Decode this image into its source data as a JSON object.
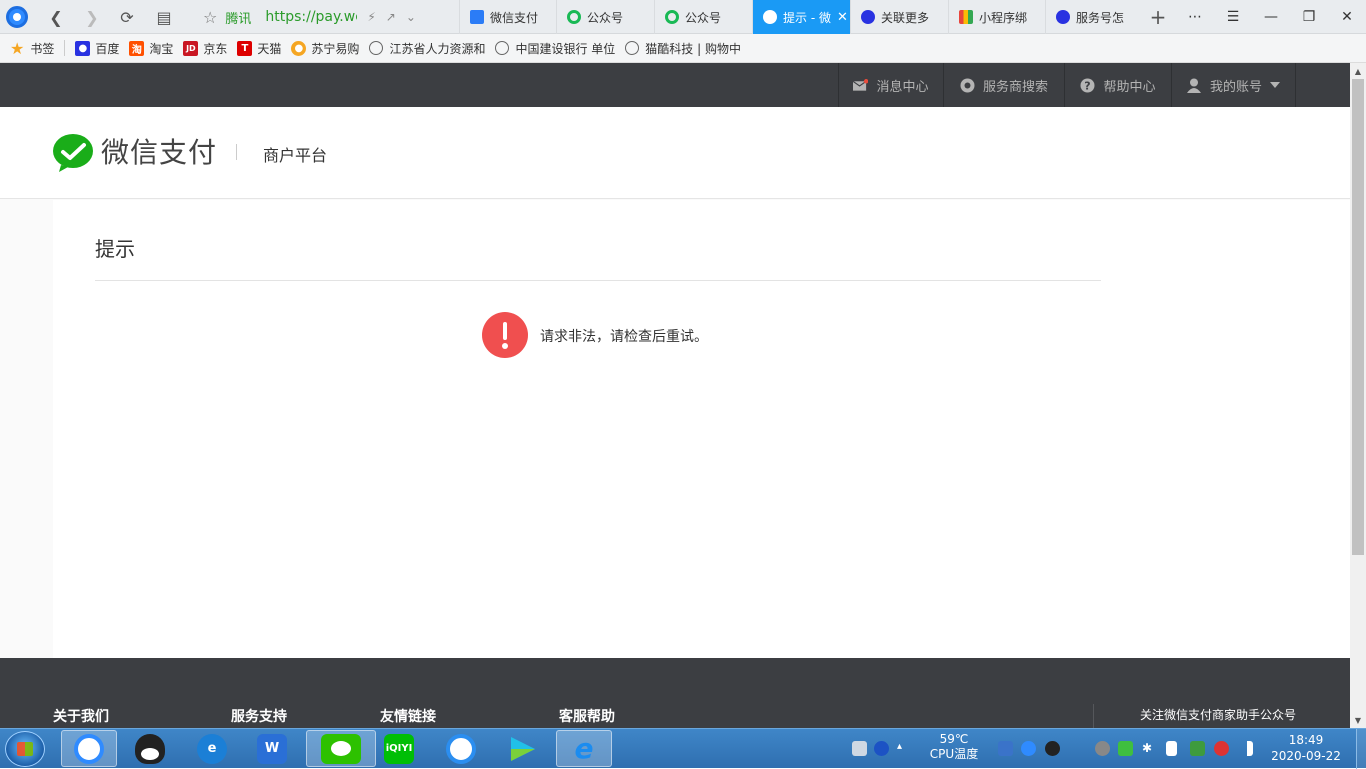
{
  "browser": {
    "address": {
      "site_label": "腾讯",
      "url": "https://pay.weixin.qq.com"
    },
    "tabs": [
      {
        "label": "微信支付",
        "icon": "doc-icon",
        "color": "#2b7cf6"
      },
      {
        "label": "公众号",
        "icon": "wechat-mp-icon",
        "color": "#19b955"
      },
      {
        "label": "公众号",
        "icon": "wechat-mp-icon",
        "color": "#19b955"
      },
      {
        "label": "提示 - 微",
        "icon": "wechat-pay-icon",
        "color": "#ffffff",
        "active": true
      },
      {
        "label": "关联更多",
        "icon": "baidu-paw-icon",
        "color": "#2932e1"
      },
      {
        "label": "小程序绑",
        "icon": "grid-apps-icon",
        "color": "#e8453c"
      },
      {
        "label": "服务号怎",
        "icon": "baidu-paw-icon",
        "color": "#2932e1"
      }
    ],
    "bookmarks": [
      {
        "label": "书签",
        "icon": "star-icon"
      },
      {
        "label": "百度",
        "icon": "baidu-paw-icon"
      },
      {
        "label": "淘宝",
        "icon": "taobao-icon"
      },
      {
        "label": "京东",
        "icon": "jd-icon"
      },
      {
        "label": "天猫",
        "icon": "tmall-icon"
      },
      {
        "label": "苏宁易购",
        "icon": "suning-icon"
      },
      {
        "label": "江苏省人力资源和",
        "icon": "globe-icon"
      },
      {
        "label": "中国建设银行 单位",
        "icon": "globe-icon"
      },
      {
        "label": "猫酷科技 | 购物中",
        "icon": "globe-icon"
      }
    ]
  },
  "topnav": {
    "messages": "消息中心",
    "provider_search": "服务商搜索",
    "help": "帮助中心",
    "account": "我的账号"
  },
  "header": {
    "brand": "微信支付",
    "platform": "商户平台"
  },
  "content": {
    "title": "提示",
    "error_message": "请求非法，请检查后重试。"
  },
  "footer": {
    "columns": [
      "关于我们",
      "服务支持",
      "友情链接",
      "客服帮助"
    ],
    "follow": "关注微信支付商家助手公众号"
  },
  "taskbar": {
    "cpu_temp_value": "59℃",
    "cpu_temp_label": "CPU温度",
    "time": "18:49",
    "date": "2020-09-22"
  },
  "colors": {
    "wechat_green": "#1aad19",
    "error_red": "#f04f4f",
    "topnav_bg": "#3c3e42",
    "active_tab": "#1a9af5"
  }
}
